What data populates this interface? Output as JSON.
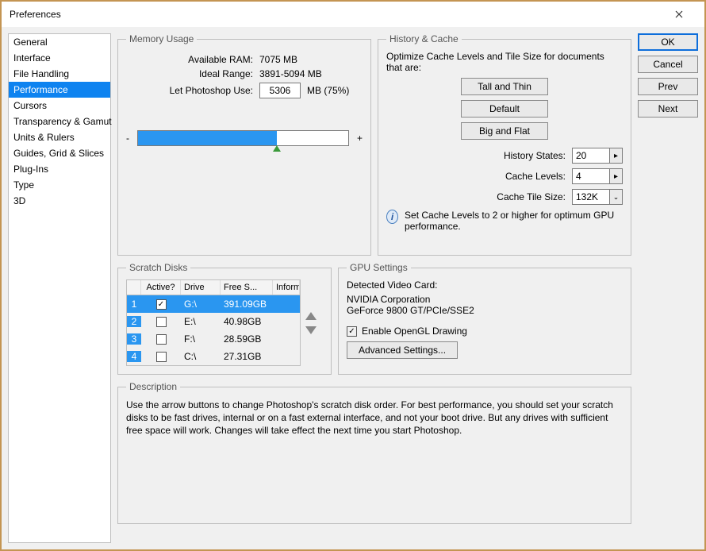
{
  "window": {
    "title": "Preferences"
  },
  "sidebar": {
    "items": [
      {
        "label": "General"
      },
      {
        "label": "Interface"
      },
      {
        "label": "File Handling"
      },
      {
        "label": "Performance",
        "selected": true
      },
      {
        "label": "Cursors"
      },
      {
        "label": "Transparency & Gamut"
      },
      {
        "label": "Units & Rulers"
      },
      {
        "label": "Guides, Grid & Slices"
      },
      {
        "label": "Plug-Ins"
      },
      {
        "label": "Type"
      },
      {
        "label": "3D"
      }
    ]
  },
  "buttons": {
    "ok": "OK",
    "cancel": "Cancel",
    "prev": "Prev",
    "next": "Next"
  },
  "memory": {
    "legend": "Memory Usage",
    "available_label": "Available RAM:",
    "available_value": "7075 MB",
    "ideal_label": "Ideal Range:",
    "ideal_value": "3891-5094 MB",
    "use_label": "Let Photoshop Use:",
    "use_value": "5306",
    "use_suffix": "MB (75%)",
    "minus": "-",
    "plus": "+"
  },
  "history": {
    "legend": "History & Cache",
    "optimize_text": "Optimize Cache Levels and Tile Size for documents that are:",
    "presets": {
      "tall": "Tall and Thin",
      "default": "Default",
      "big": "Big and Flat"
    },
    "states_label": "History States:",
    "states_value": "20",
    "levels_label": "Cache Levels:",
    "levels_value": "4",
    "tile_label": "Cache Tile Size:",
    "tile_value": "132K",
    "info_text": "Set Cache Levels to 2 or higher for optimum GPU performance."
  },
  "scratch": {
    "legend": "Scratch Disks",
    "headers": {
      "active": "Active?",
      "drive": "Drive",
      "free": "Free S...",
      "info": "Informat..."
    },
    "rows": [
      {
        "idx": "1",
        "active": true,
        "drive": "G:\\",
        "free": "391.09GB",
        "selected": true
      },
      {
        "idx": "2",
        "active": false,
        "drive": "E:\\",
        "free": "40.98GB"
      },
      {
        "idx": "3",
        "active": false,
        "drive": "F:\\",
        "free": "28.59GB"
      },
      {
        "idx": "4",
        "active": false,
        "drive": "C:\\",
        "free": "27.31GB"
      }
    ]
  },
  "gpu": {
    "legend": "GPU Settings",
    "detected_label": "Detected Video Card:",
    "vendor": "NVIDIA Corporation",
    "model": "GeForce 9800 GT/PCIe/SSE2",
    "enable_label": "Enable OpenGL Drawing",
    "enable_checked": true,
    "advanced": "Advanced Settings..."
  },
  "description": {
    "legend": "Description",
    "text": "Use the arrow buttons to change Photoshop's scratch disk order. For best performance, you should set your scratch disks to be fast drives, internal or on a fast external interface, and not your boot drive. But any drives with sufficient free space will work. Changes will take effect the next time you start Photoshop."
  }
}
